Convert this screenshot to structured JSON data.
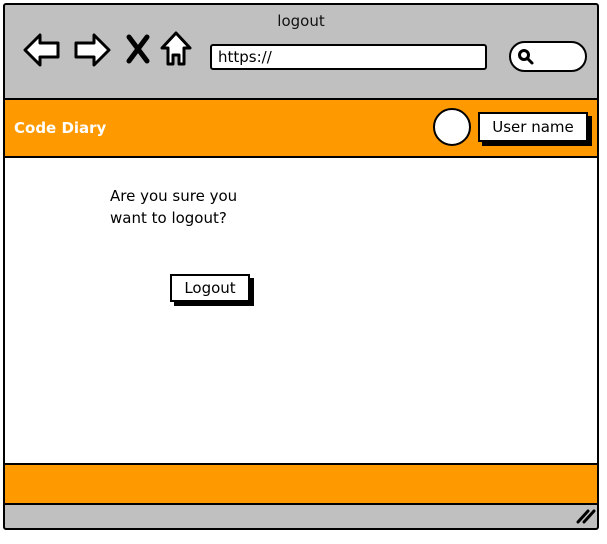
{
  "window": {
    "title": "logout"
  },
  "toolbar": {
    "icons": [
      "back-arrow-icon",
      "forward-arrow-icon",
      "close-icon",
      "home-icon"
    ],
    "url": "https://",
    "search_icon": "search-icon"
  },
  "header": {
    "brand": "Code Diary",
    "user_label": "User name",
    "avatar_icon": "avatar-circle"
  },
  "main": {
    "prompt_line1": "Are you sure you",
    "prompt_line2": "want to logout?",
    "logout_label": "Logout"
  },
  "colors": {
    "accent": "#ff9900",
    "chrome": "#c0c0c0",
    "border": "#000000",
    "brand_text": "#ffffff"
  }
}
